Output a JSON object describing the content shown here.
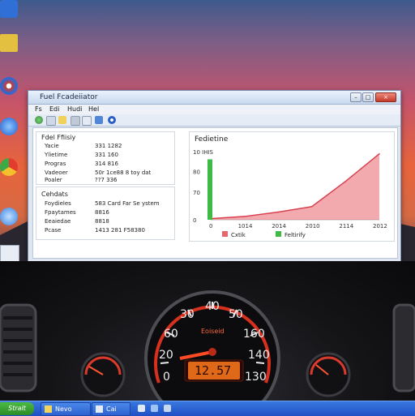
{
  "desktop": {
    "icons": [
      {
        "name": "desktop-icon-1",
        "label": ""
      },
      {
        "name": "desktop-icon-2",
        "label": ""
      },
      {
        "name": "desktop-icon-3",
        "label": ""
      },
      {
        "name": "desktop-icon-4",
        "label": ""
      },
      {
        "name": "desktop-icon-5",
        "label": ""
      },
      {
        "name": "desktop-icon-6",
        "label": ""
      },
      {
        "name": "desktop-icon-7",
        "label": ""
      }
    ]
  },
  "window": {
    "title": "Fuel Fcadeiiator",
    "menu": [
      "Fs",
      "Edi",
      "Hudi",
      "Hel"
    ],
    "controls": {
      "minimize": "–",
      "maximize": "□",
      "close": "×"
    }
  },
  "left_panel_top": {
    "title": "Fdel Ffiisiy",
    "rows": [
      {
        "label": "Yacie",
        "value": "331 1282"
      },
      {
        "label": "Ylietime",
        "value": "331 160"
      },
      {
        "label": "Progras",
        "value": "314 816"
      },
      {
        "label": "Vadeoer",
        "value": "50r 1ce88 8 toy dat"
      },
      {
        "label": "Poaler",
        "value": "??7 336"
      }
    ]
  },
  "left_panel_bottom": {
    "title": "Cehdats",
    "rows": [
      {
        "label": "Foydieles",
        "value": "583 Card Far Se ystem"
      },
      {
        "label": "Fpaytames",
        "value": "8816"
      },
      {
        "label": "Eeaiedae",
        "value": "8818"
      },
      {
        "label": "Pcase",
        "value": "1413 281 F58380"
      }
    ]
  },
  "chart_panel": {
    "title": "Fedietine"
  },
  "chart_data": {
    "type": "area",
    "title": "Fedietine",
    "y_ticks": [
      "10 IHIS",
      "80",
      "70",
      "0"
    ],
    "x_ticks": [
      "0",
      "1014",
      "2014",
      "2010",
      "2114",
      "2012"
    ],
    "x": [
      0,
      1,
      2,
      3,
      4,
      5
    ],
    "series": [
      {
        "name": "Cxtik",
        "color": "#e8646e",
        "values": [
          1,
          3,
          7,
          12,
          35,
          60
        ]
      },
      {
        "name": "Feltirify",
        "color": "#3dbb44",
        "values": [
          0,
          0,
          0,
          0,
          0,
          0
        ]
      }
    ],
    "bar": {
      "series": "Feltirify",
      "x": 0,
      "value": 55
    },
    "ylim": [
      0,
      62
    ]
  },
  "dashboard": {
    "speedometer_labels": [
      "0",
      "20",
      "60",
      "30",
      "40",
      "50",
      "160",
      "140",
      "130"
    ],
    "readout": "12.57",
    "subtitle": "Eoiseid"
  },
  "taskbar": {
    "start_label": "Stralt",
    "tasks": [
      {
        "label": "Nevo"
      },
      {
        "label": "Cai"
      }
    ]
  },
  "colors": {
    "accent_red": "#e8646e",
    "accent_green": "#3dbb44",
    "taskbar_blue": "#245edb"
  }
}
